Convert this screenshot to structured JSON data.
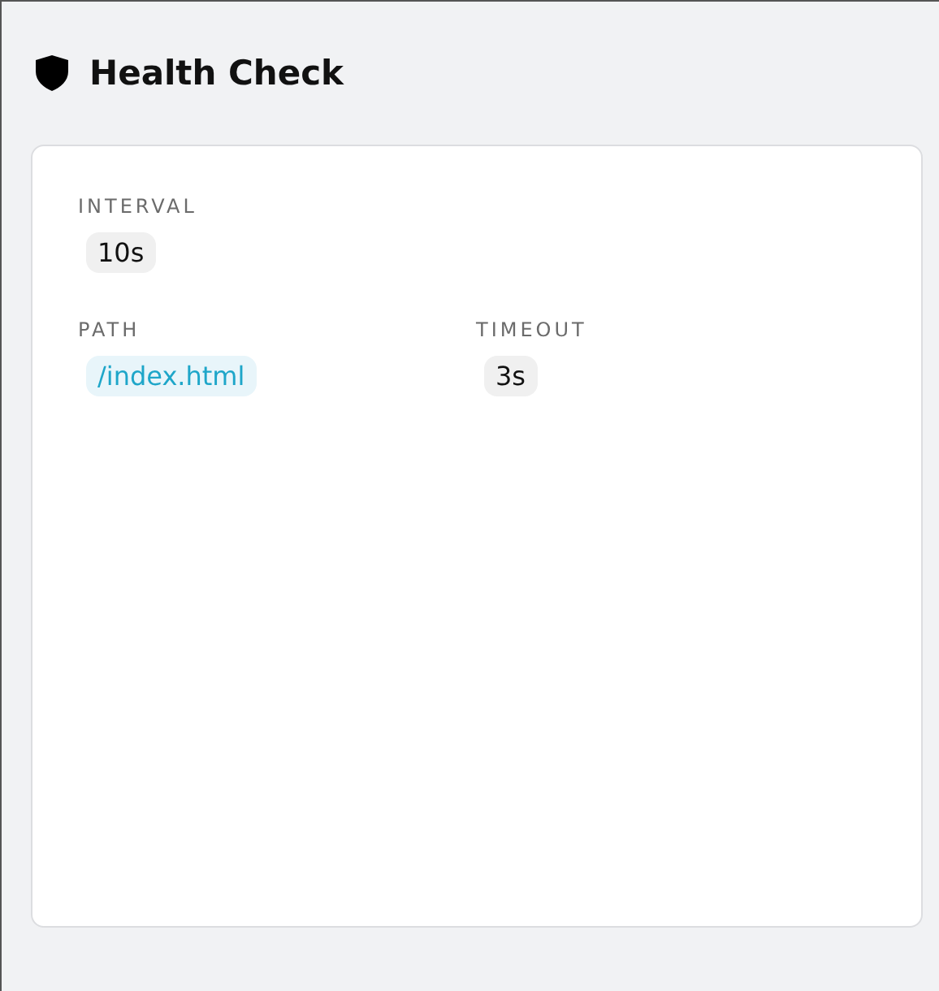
{
  "header": {
    "title": "Health Check"
  },
  "rows": [
    [
      {
        "label": "INTERVAL",
        "value": "10s",
        "kind": "plain"
      }
    ],
    [
      {
        "label": "PATH",
        "value": "/index.html",
        "kind": "link"
      },
      {
        "label": "TIMEOUT",
        "value": "3s",
        "kind": "plain"
      }
    ]
  ]
}
